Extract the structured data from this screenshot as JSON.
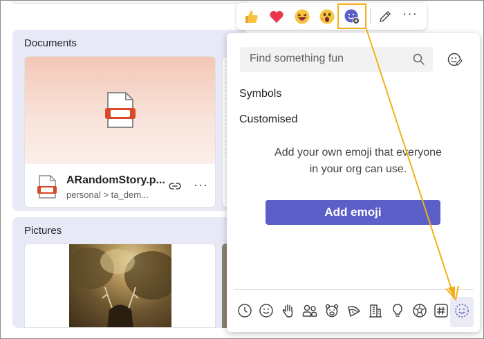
{
  "documents": {
    "title": "Documents",
    "file": {
      "name": "ARandomStory.p...",
      "path": "personal > ta_dem..."
    }
  },
  "pictures": {
    "title": "Pictures"
  },
  "reaction_bar": {
    "reactions": [
      "thumbs-up",
      "heart",
      "laughing",
      "surprised",
      "custom-emoji-add"
    ],
    "highlight_color": "#f2b019"
  },
  "picker": {
    "search_placeholder": "Find something fun",
    "categories": [
      "Symbols",
      "Customised"
    ],
    "empty_message_line1": "Add your own emoji that everyone",
    "empty_message_line2": "in your org can use.",
    "add_button_label": "Add emoji",
    "category_bar": [
      "recent",
      "smileys",
      "hand-gestures",
      "people",
      "animals",
      "food",
      "buildings",
      "objects",
      "activities",
      "symbols",
      "custom"
    ],
    "accent": "#5b5fc7"
  },
  "annotation_color": "#f2b019"
}
